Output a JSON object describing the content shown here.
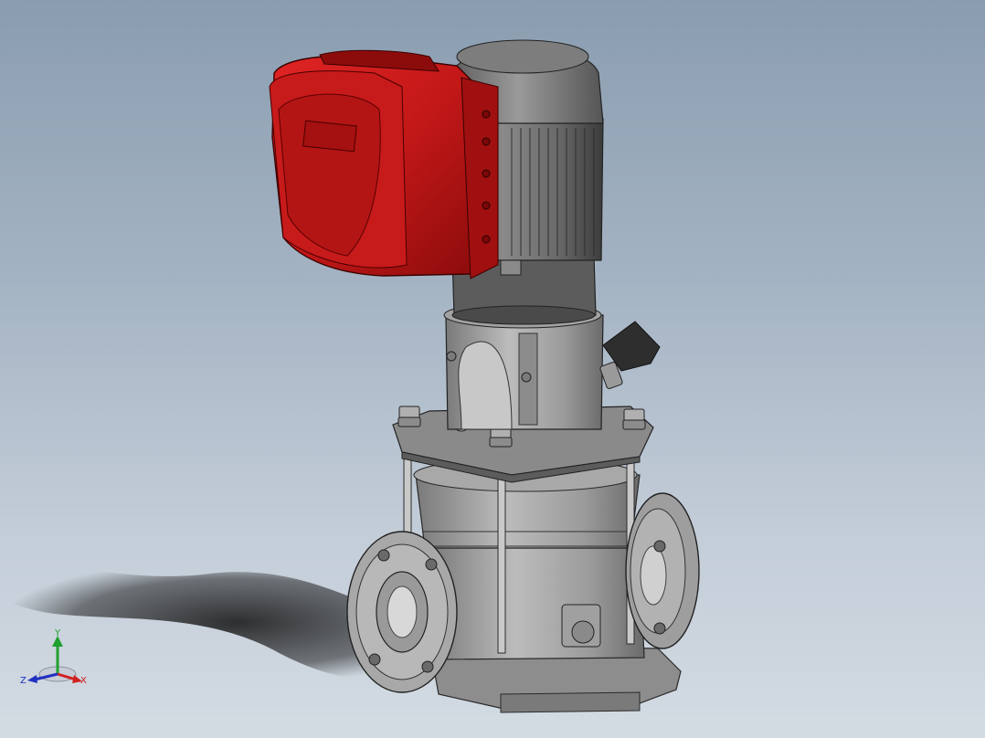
{
  "viewport": {
    "background_top": "#8a9db0",
    "background_bottom": "#d3dbe3"
  },
  "model": {
    "motor_color": "#6e6e6e",
    "drive_color": "#c8191b",
    "pump_color": "#9a9a9a"
  },
  "triad": {
    "x_label": "X",
    "y_label": "Y",
    "z_label": "Z",
    "x_color": "#d02020",
    "y_color": "#20a030",
    "z_color": "#2030c0"
  }
}
